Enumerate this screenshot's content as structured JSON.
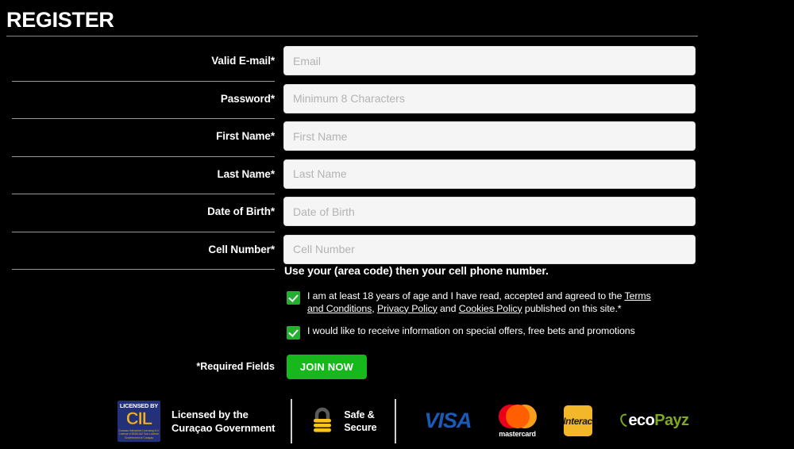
{
  "page": {
    "title": "REGISTER",
    "background_color": "#000000"
  },
  "form": {
    "fields": [
      {
        "label": "Valid E-mail*",
        "placeholder": "Email",
        "value": "",
        "type": "email"
      },
      {
        "label": "Password*",
        "placeholder": "Minimum 8 Characters",
        "value": "",
        "type": "password"
      },
      {
        "label": "First Name*",
        "placeholder": "First Name",
        "value": "",
        "type": "text"
      },
      {
        "label": "Last Name*",
        "placeholder": "Last Name",
        "value": "",
        "type": "text"
      },
      {
        "label": "Date of Birth*",
        "placeholder": "Date of Birth",
        "value": "",
        "type": "text"
      },
      {
        "label": "Cell Number*",
        "placeholder": "Cell Number",
        "value": "",
        "type": "tel"
      }
    ],
    "helper_text": "Use your (area code) then your cell phone number.",
    "required_note": "*Required Fields",
    "submit_label": "JOIN NOW",
    "submit_color": "#16b81b"
  },
  "consents": {
    "terms": {
      "checked": true,
      "text_before": "I am at least 18 years of age and I have read, accepted and agreed to the ",
      "link_terms": "Terms and Conditions",
      "separator_1": ", ",
      "link_privacy": "Privacy Policy",
      "separator_2": " and ",
      "link_cookies": "Cookies Policy",
      "text_after": " published on this site.*"
    },
    "offers": {
      "checked": true,
      "text": "I would like to receive information on special offers, free bets and promotions"
    },
    "checkbox_color": "#22b02e"
  },
  "footer": {
    "license": {
      "logo_top": "LICENSED BY",
      "logo_mid": "CIL",
      "logo_bottom": "Curacao Interactive Licensing N.V. License # 5536/JAZ Sub-License Government of Curaçao",
      "text_line1": "Licensed by the",
      "text_line2": "Curaçao Government"
    },
    "security": {
      "text_line1": "Safe &",
      "text_line2": "Secure"
    },
    "payments": [
      {
        "name": "VISA",
        "label": "VISA"
      },
      {
        "name": "mastercard",
        "label": "mastercard"
      },
      {
        "name": "Interac",
        "label": "Interac"
      },
      {
        "name": "ecoPayz",
        "label_part1": "eco",
        "label_part2": "Payz"
      }
    ]
  }
}
